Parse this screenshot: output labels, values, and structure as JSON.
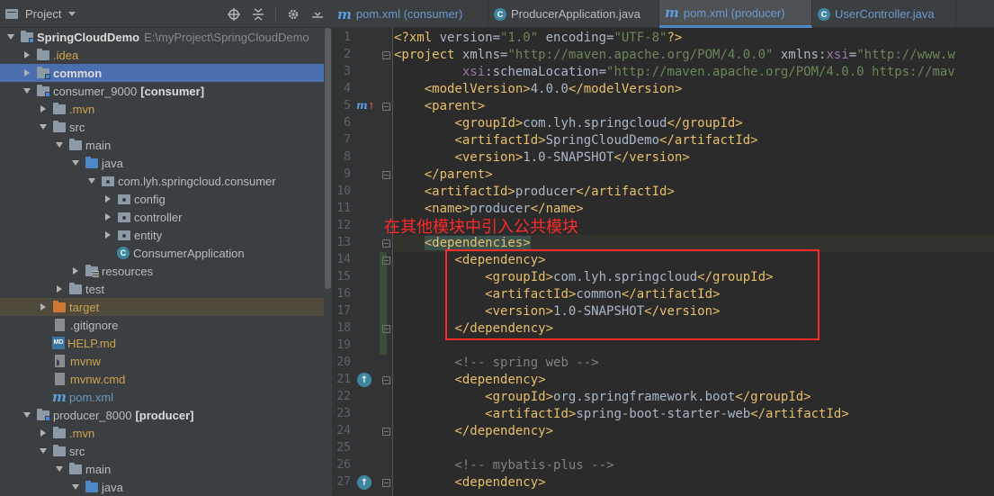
{
  "project_panel": {
    "title": "Project",
    "tree": [
      {
        "label": "SpringCloudDemo",
        "extra": "E:\\myProject\\SpringCloudDemo",
        "icon": "module-folder-icon",
        "expanded": true
      },
      {
        "label": ".idea",
        "icon": "folder-icon",
        "expanded": false
      },
      {
        "label": "common",
        "icon": "module-folder-icon",
        "expanded": false,
        "selected": true
      },
      {
        "label": "consumer_9000",
        "extra": "[consumer]",
        "icon": "module-folder-icon",
        "expanded": true
      },
      {
        "label": ".mvn",
        "icon": "folder-icon",
        "expanded": false
      },
      {
        "label": "src",
        "icon": "folder-icon",
        "expanded": true
      },
      {
        "label": "main",
        "icon": "folder-icon",
        "expanded": true
      },
      {
        "label": "java",
        "icon": "source-folder-icon",
        "expanded": true
      },
      {
        "label": "com.lyh.springcloud.consumer",
        "icon": "package-icon",
        "expanded": true
      },
      {
        "label": "config",
        "icon": "package-icon",
        "expanded": false
      },
      {
        "label": "controller",
        "icon": "package-icon",
        "expanded": false
      },
      {
        "label": "entity",
        "icon": "package-icon",
        "expanded": false
      },
      {
        "label": "ConsumerApplication",
        "icon": "class-icon"
      },
      {
        "label": "resources",
        "icon": "resources-folder-icon",
        "expanded": false
      },
      {
        "label": "test",
        "icon": "folder-icon",
        "expanded": false
      },
      {
        "label": "target",
        "icon": "excluded-folder-icon",
        "expanded": false
      },
      {
        "label": ".gitignore",
        "icon": "gitignore-file-icon"
      },
      {
        "label": "HELP.md",
        "icon": "markdown-file-icon"
      },
      {
        "label": "mvnw",
        "icon": "script-file-icon"
      },
      {
        "label": "mvnw.cmd",
        "icon": "text-file-icon"
      },
      {
        "label": "pom.xml",
        "icon": "maven-icon"
      },
      {
        "label": "producer_8000",
        "extra": "[producer]",
        "icon": "module-folder-icon",
        "expanded": true
      },
      {
        "label": ".mvn",
        "icon": "folder-icon",
        "expanded": false
      },
      {
        "label": "src",
        "icon": "folder-icon",
        "expanded": true
      },
      {
        "label": "main",
        "icon": "folder-icon",
        "expanded": true
      },
      {
        "label": "java",
        "icon": "source-folder-icon",
        "expanded": true
      }
    ]
  },
  "tabs": [
    {
      "label": "pom.xml (consumer)",
      "icon": "maven-icon",
      "active": false
    },
    {
      "label": "ProducerApplication.java",
      "icon": "class-icon",
      "active": false
    },
    {
      "label": "pom.xml (producer)",
      "icon": "maven-icon",
      "active": true
    },
    {
      "label": "UserController.java",
      "icon": "class-icon",
      "active": false
    }
  ],
  "editor": {
    "line_numbers": [
      "1",
      "2",
      "3",
      "4",
      "5",
      "6",
      "7",
      "8",
      "9",
      "10",
      "11",
      "12",
      "13",
      "14",
      "15",
      "16",
      "17",
      "18",
      "19",
      "20",
      "21",
      "22",
      "23",
      "24",
      "25",
      "26",
      "27"
    ],
    "lines": {
      "l1": [
        [
          "tg",
          "<?xml "
        ],
        [
          "tx",
          "version="
        ],
        [
          "st",
          "\"1.0\" "
        ],
        [
          "tx",
          "encoding="
        ],
        [
          "st",
          "\"UTF-8\""
        ],
        [
          "tg",
          "?>"
        ]
      ],
      "l2": [
        [
          "tg",
          "<project "
        ],
        [
          "tx",
          "xmlns="
        ],
        [
          "st",
          "\"http://maven.apache.org/POM/4.0.0\" "
        ],
        [
          "tx",
          "xmlns:"
        ],
        [
          "ns",
          "xsi"
        ],
        [
          "tx",
          "="
        ],
        [
          "st",
          "\"http://www.w"
        ]
      ],
      "l3": [
        [
          "tx",
          "         "
        ],
        [
          "ns",
          "xsi"
        ],
        [
          "tx",
          ":schemaLocation="
        ],
        [
          "st",
          "\"http://maven.apache.org/POM/4.0.0 https://mav"
        ]
      ],
      "l4": [
        [
          "tx",
          "    "
        ],
        [
          "tg",
          "<modelVersion>"
        ],
        [
          "tx",
          "4.0.0"
        ],
        [
          "tg",
          "</modelVersion>"
        ]
      ],
      "l5": [
        [
          "tx",
          "    "
        ],
        [
          "tg",
          "<parent>"
        ]
      ],
      "l6": [
        [
          "tx",
          "        "
        ],
        [
          "tg",
          "<groupId>"
        ],
        [
          "tx",
          "com.lyh.springcloud"
        ],
        [
          "tg",
          "</groupId>"
        ]
      ],
      "l7": [
        [
          "tx",
          "        "
        ],
        [
          "tg",
          "<artifactId>"
        ],
        [
          "tx",
          "SpringCloudDemo"
        ],
        [
          "tg",
          "</artifactId>"
        ]
      ],
      "l8": [
        [
          "tx",
          "        "
        ],
        [
          "tg",
          "<version>"
        ],
        [
          "tx",
          "1.0-SNAPSHOT"
        ],
        [
          "tg",
          "</version>"
        ]
      ],
      "l9": [
        [
          "tx",
          "    "
        ],
        [
          "tg",
          "</parent>"
        ]
      ],
      "l10": [
        [
          "tx",
          "    "
        ],
        [
          "tg",
          "<artifactId>"
        ],
        [
          "tx",
          "producer"
        ],
        [
          "tg",
          "</artifactId>"
        ]
      ],
      "l11": [
        [
          "tx",
          "    "
        ],
        [
          "tg",
          "<name>"
        ],
        [
          "tx",
          "producer"
        ],
        [
          "tg",
          "</name>"
        ]
      ],
      "l12": [],
      "l13": [
        [
          "tx",
          "    "
        ],
        [
          "tg-hl",
          "<dependencies>"
        ]
      ],
      "l14": [
        [
          "tx",
          "        "
        ],
        [
          "tg",
          "<dependency>"
        ]
      ],
      "l15": [
        [
          "tx",
          "            "
        ],
        [
          "tg",
          "<groupId>"
        ],
        [
          "tx",
          "com.lyh.springcloud"
        ],
        [
          "tg",
          "</groupId>"
        ]
      ],
      "l16": [
        [
          "tx",
          "            "
        ],
        [
          "tg",
          "<artifactId>"
        ],
        [
          "tx",
          "common"
        ],
        [
          "tg",
          "</artifactId>"
        ]
      ],
      "l17": [
        [
          "tx",
          "            "
        ],
        [
          "tg",
          "<version>"
        ],
        [
          "tx",
          "1.0-SNAPSHOT"
        ],
        [
          "tg",
          "</version>"
        ]
      ],
      "l18": [
        [
          "tx",
          "        "
        ],
        [
          "tg",
          "</dependency>"
        ]
      ],
      "l19": [],
      "l20": [
        [
          "tx",
          "        "
        ],
        [
          "cm",
          "<!-- spring web -->"
        ]
      ],
      "l21": [
        [
          "tx",
          "        "
        ],
        [
          "tg",
          "<dependency>"
        ]
      ],
      "l22": [
        [
          "tx",
          "            "
        ],
        [
          "tg",
          "<groupId>"
        ],
        [
          "tx",
          "org.springframework.boot"
        ],
        [
          "tg",
          "</groupId>"
        ]
      ],
      "l23": [
        [
          "tx",
          "            "
        ],
        [
          "tg",
          "<artifactId>"
        ],
        [
          "tx",
          "spring-boot-starter-web"
        ],
        [
          "tg",
          "</artifactId>"
        ]
      ],
      "l24": [
        [
          "tx",
          "        "
        ],
        [
          "tg",
          "</dependency>"
        ]
      ],
      "l25": [],
      "l26": [
        [
          "tx",
          "        "
        ],
        [
          "cm",
          "<!-- mybatis-plus -->"
        ]
      ],
      "l27": [
        [
          "tx",
          "        "
        ],
        [
          "tg",
          "<dependency>"
        ]
      ]
    }
  },
  "annotation": {
    "text": "在其他模块中引入公共模块",
    "color": "#ff2a2a"
  },
  "colors": {
    "tag": "#e8bf6a",
    "string": "#6a8759",
    "text": "#a9b7c6",
    "comment": "#808080",
    "selection": "#4b6eaf"
  }
}
